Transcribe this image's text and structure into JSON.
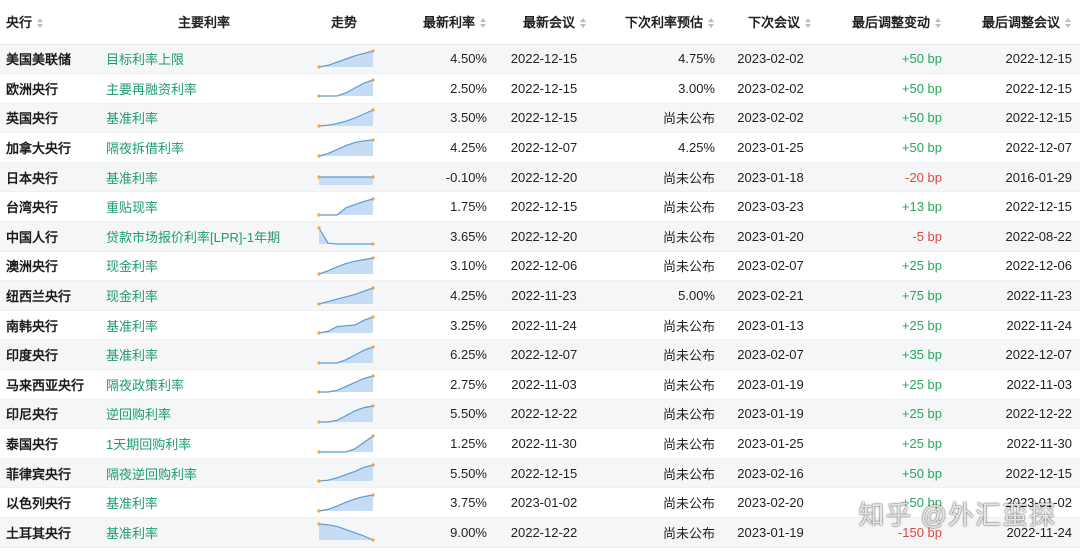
{
  "headers": {
    "bank": "央行",
    "rate_name": "主要利率",
    "trend": "走势",
    "latest_rate": "最新利率",
    "latest_meeting": "最新会议",
    "next_forecast": "下次利率预估",
    "next_meeting": "下次会议",
    "last_change": "最后调整变动",
    "last_change_meeting": "最后调整会议"
  },
  "icons": {
    "sort": "sort-arrows-icon"
  },
  "colors": {
    "rate_name": "#1e9c6e",
    "positive": "#26a65b",
    "negative": "#e0483a",
    "spark_line": "#5b9bd5",
    "spark_fill": "#c6dcf5",
    "spark_dot": "#f0a23b"
  },
  "rows": [
    {
      "bank": "美国美联储",
      "rate_name": "目标利率上限",
      "latest_rate": "4.50%",
      "latest_meeting": "2022-12-15",
      "next_forecast": "4.75%",
      "next_meeting": "2023-02-02",
      "last_change": "+50 bp",
      "last_change_meeting": "2022-12-15",
      "direction": "up",
      "trend": [
        0.0,
        0.1,
        0.3,
        0.5,
        0.7,
        0.85,
        1.0
      ]
    },
    {
      "bank": "欧洲央行",
      "rate_name": "主要再融资利率",
      "latest_rate": "2.50%",
      "latest_meeting": "2022-12-15",
      "next_forecast": "3.00%",
      "next_meeting": "2023-02-02",
      "last_change": "+50 bp",
      "last_change_meeting": "2022-12-15",
      "direction": "up",
      "trend": [
        0.0,
        0.0,
        0.0,
        0.2,
        0.5,
        0.8,
        1.0
      ]
    },
    {
      "bank": "英国央行",
      "rate_name": "基准利率",
      "latest_rate": "3.50%",
      "latest_meeting": "2022-12-15",
      "next_forecast": "尚未公布",
      "next_meeting": "2023-02-02",
      "last_change": "+50 bp",
      "last_change_meeting": "2022-12-15",
      "direction": "up",
      "trend": [
        0.0,
        0.05,
        0.15,
        0.3,
        0.5,
        0.75,
        1.0
      ]
    },
    {
      "bank": "加拿大央行",
      "rate_name": "隔夜拆借利率",
      "latest_rate": "4.25%",
      "latest_meeting": "2022-12-07",
      "next_forecast": "4.25%",
      "next_meeting": "2023-01-25",
      "last_change": "+50 bp",
      "last_change_meeting": "2022-12-07",
      "direction": "up",
      "trend": [
        0.0,
        0.15,
        0.4,
        0.65,
        0.85,
        0.95,
        1.0
      ]
    },
    {
      "bank": "日本央行",
      "rate_name": "基准利率",
      "latest_rate": "-0.10%",
      "latest_meeting": "2022-12-20",
      "next_forecast": "尚未公布",
      "next_meeting": "2023-01-18",
      "last_change": "-20 bp",
      "last_change_meeting": "2016-01-29",
      "direction": "down",
      "trend": [
        0.5,
        0.5,
        0.5,
        0.5,
        0.5,
        0.5,
        0.5
      ]
    },
    {
      "bank": "台湾央行",
      "rate_name": "重贴现率",
      "latest_rate": "1.75%",
      "latest_meeting": "2022-12-15",
      "next_forecast": "尚未公布",
      "next_meeting": "2023-03-23",
      "last_change": "+13 bp",
      "last_change_meeting": "2022-12-15",
      "direction": "up",
      "trend": [
        0.0,
        0.0,
        0.0,
        0.45,
        0.65,
        0.85,
        1.0
      ]
    },
    {
      "bank": "中国人行",
      "rate_name": "贷款市场报价利率[LPR]-1年期",
      "latest_rate": "3.65%",
      "latest_meeting": "2022-12-20",
      "next_forecast": "尚未公布",
      "next_meeting": "2023-01-20",
      "last_change": "-5 bp",
      "last_change_meeting": "2022-08-22",
      "direction": "down",
      "trend": [
        1.0,
        0.05,
        0.0,
        0.0,
        0.0,
        0.0,
        0.0
      ]
    },
    {
      "bank": "澳洲央行",
      "rate_name": "现金利率",
      "latest_rate": "3.10%",
      "latest_meeting": "2022-12-06",
      "next_forecast": "尚未公布",
      "next_meeting": "2023-02-07",
      "last_change": "+25 bp",
      "last_change_meeting": "2022-12-06",
      "direction": "up",
      "trend": [
        0.0,
        0.2,
        0.45,
        0.65,
        0.8,
        0.9,
        1.0
      ]
    },
    {
      "bank": "纽西兰央行",
      "rate_name": "现金利率",
      "latest_rate": "4.25%",
      "latest_meeting": "2022-11-23",
      "next_forecast": "5.00%",
      "next_meeting": "2023-02-21",
      "last_change": "+75 bp",
      "last_change_meeting": "2022-11-23",
      "direction": "up",
      "trend": [
        0.0,
        0.15,
        0.3,
        0.45,
        0.6,
        0.8,
        1.0
      ]
    },
    {
      "bank": "南韩央行",
      "rate_name": "基准利率",
      "latest_rate": "3.25%",
      "latest_meeting": "2022-11-24",
      "next_forecast": "尚未公布",
      "next_meeting": "2023-01-13",
      "last_change": "+25 bp",
      "last_change_meeting": "2022-11-24",
      "direction": "up",
      "trend": [
        0.0,
        0.1,
        0.4,
        0.45,
        0.5,
        0.8,
        1.0
      ]
    },
    {
      "bank": "印度央行",
      "rate_name": "基准利率",
      "latest_rate": "6.25%",
      "latest_meeting": "2022-12-07",
      "next_forecast": "尚未公布",
      "next_meeting": "2023-02-07",
      "last_change": "+35 bp",
      "last_change_meeting": "2022-12-07",
      "direction": "up",
      "trend": [
        0.0,
        0.0,
        0.0,
        0.2,
        0.5,
        0.8,
        1.0
      ]
    },
    {
      "bank": "马来西亚央行",
      "rate_name": "隔夜政策利率",
      "latest_rate": "2.75%",
      "latest_meeting": "2022-11-03",
      "next_forecast": "尚未公布",
      "next_meeting": "2023-01-19",
      "last_change": "+25 bp",
      "last_change_meeting": "2022-11-03",
      "direction": "up",
      "trend": [
        0.0,
        0.0,
        0.1,
        0.35,
        0.6,
        0.85,
        1.0
      ]
    },
    {
      "bank": "印尼央行",
      "rate_name": "逆回购利率",
      "latest_rate": "5.50%",
      "latest_meeting": "2022-12-22",
      "next_forecast": "尚未公布",
      "next_meeting": "2023-01-19",
      "last_change": "+25 bp",
      "last_change_meeting": "2022-12-22",
      "direction": "up",
      "trend": [
        0.0,
        0.0,
        0.1,
        0.4,
        0.7,
        0.9,
        1.0
      ]
    },
    {
      "bank": "泰国央行",
      "rate_name": "1天期回购利率",
      "latest_rate": "1.25%",
      "latest_meeting": "2022-11-30",
      "next_forecast": "尚未公布",
      "next_meeting": "2023-01-25",
      "last_change": "+25 bp",
      "last_change_meeting": "2022-11-30",
      "direction": "up",
      "trend": [
        0.0,
        0.0,
        0.0,
        0.0,
        0.2,
        0.6,
        1.0
      ]
    },
    {
      "bank": "菲律宾央行",
      "rate_name": "隔夜逆回购利率",
      "latest_rate": "5.50%",
      "latest_meeting": "2022-12-15",
      "next_forecast": "尚未公布",
      "next_meeting": "2023-02-16",
      "last_change": "+50 bp",
      "last_change_meeting": "2022-12-15",
      "direction": "up",
      "trend": [
        0.0,
        0.05,
        0.2,
        0.4,
        0.6,
        0.85,
        1.0
      ]
    },
    {
      "bank": "以色列央行",
      "rate_name": "基准利率",
      "latest_rate": "3.75%",
      "latest_meeting": "2023-01-02",
      "next_forecast": "尚未公布",
      "next_meeting": "2023-02-20",
      "last_change": "+50 bp",
      "last_change_meeting": "2023-01-02",
      "direction": "up",
      "trend": [
        0.0,
        0.1,
        0.3,
        0.55,
        0.75,
        0.9,
        1.0
      ]
    },
    {
      "bank": "土耳其央行",
      "rate_name": "基准利率",
      "latest_rate": "9.00%",
      "latest_meeting": "2022-12-22",
      "next_forecast": "尚未公布",
      "next_meeting": "2023-01-19",
      "last_change": "-150 bp",
      "last_change_meeting": "2022-11-24",
      "direction": "down",
      "trend": [
        1.0,
        0.95,
        0.85,
        0.65,
        0.45,
        0.25,
        0.0
      ]
    }
  ],
  "watermark": "知乎 @外汇蛮探"
}
